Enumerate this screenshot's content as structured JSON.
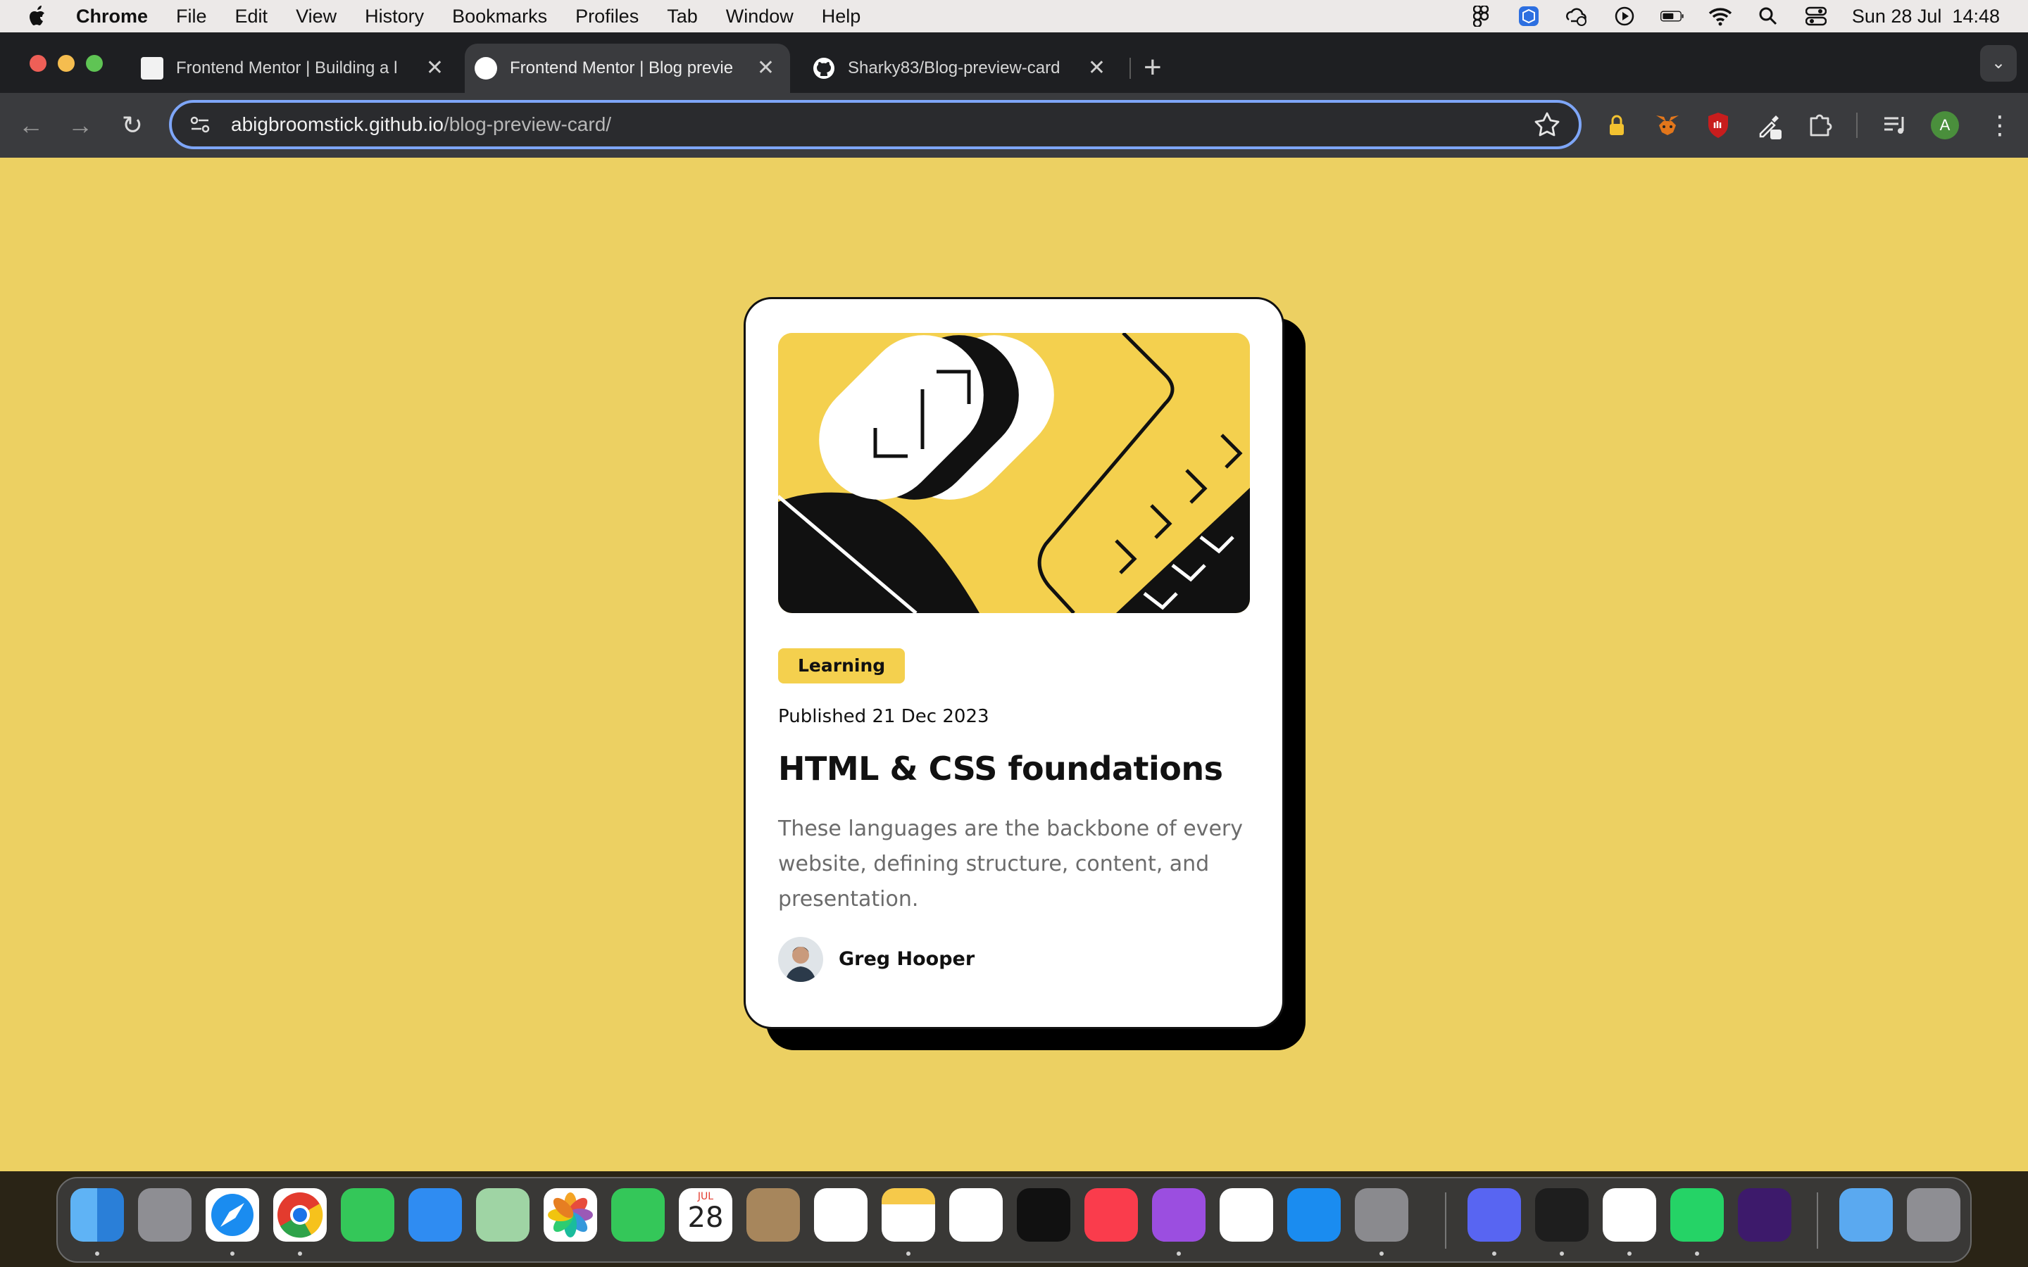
{
  "menubar": {
    "app_name": "Chrome",
    "items": [
      "File",
      "Edit",
      "View",
      "History",
      "Bookmarks",
      "Profiles",
      "Tab",
      "Window",
      "Help"
    ],
    "clock": "Sun 28 Jul  14:48"
  },
  "browser": {
    "tabs": [
      {
        "title": "Frontend Mentor | Building a l",
        "active": false
      },
      {
        "title": "Frontend Mentor | Blog previe",
        "active": true
      },
      {
        "title": "Sharky83/Blog-preview-card",
        "active": false
      }
    ],
    "address": {
      "host": "abigbroomstick.github.io",
      "path": "/blog-preview-card/"
    },
    "profile_initial": "A"
  },
  "card": {
    "tag": "Learning",
    "published": "Published 21 Dec 2023",
    "title": "HTML & CSS foundations",
    "description": "These languages are the backbone of every website, defining structure, content, and presentation.",
    "author": "Greg Hooper"
  },
  "colors": {
    "page_background": "#ecd062",
    "accent_yellow": "#f4d04e",
    "card_background": "#ffffff",
    "text_dark": "#111111",
    "text_muted": "#6b6b6b",
    "omnibox_focus": "#7ea6f8"
  },
  "dock": {
    "calendar_month": "JUL",
    "calendar_day": "28",
    "apps": [
      "finder-icon",
      "launchpad-icon",
      "safari-icon",
      "chrome-icon",
      "messages-icon",
      "mail-icon",
      "maps-icon",
      "photos-icon",
      "facetime-icon",
      "calendar-icon",
      "contacts-icon",
      "reminders-icon",
      "notes-icon",
      "freeform-icon",
      "appletv-icon",
      "music-icon",
      "podcasts-icon",
      "news-icon",
      "appstore-icon",
      "system-settings-icon",
      "discord-icon",
      "figma-icon",
      "vscode-icon",
      "whatsapp-icon",
      "tor-browser-icon",
      "downloads-folder-icon",
      "trash-icon"
    ]
  }
}
